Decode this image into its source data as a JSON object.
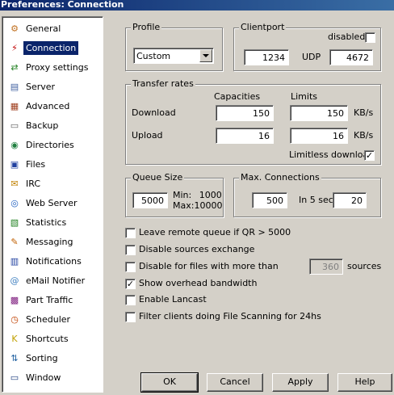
{
  "window": {
    "title": "Preferences: Connection"
  },
  "sidebar": {
    "items": [
      {
        "label": "General",
        "icon": "gear-icon",
        "color": "#c07020",
        "glyph": "⚙",
        "selected": false
      },
      {
        "label": "Connection",
        "icon": "plug-icon",
        "color": "#c00000",
        "glyph": "⚡",
        "selected": true
      },
      {
        "label": "Proxy settings",
        "icon": "proxy-icon",
        "color": "#208020",
        "glyph": "⇄",
        "selected": false
      },
      {
        "label": "Server",
        "icon": "server-icon",
        "color": "#4060a0",
        "glyph": "▤",
        "selected": false
      },
      {
        "label": "Advanced",
        "icon": "advanced-icon",
        "color": "#a04020",
        "glyph": "▦",
        "selected": false
      },
      {
        "label": "Backup",
        "icon": "backup-icon",
        "color": "#606060",
        "glyph": "▭",
        "selected": false
      },
      {
        "label": "Directories",
        "icon": "directories-icon",
        "color": "#208040",
        "glyph": "◉",
        "selected": false
      },
      {
        "label": "Files",
        "icon": "files-icon",
        "color": "#2040a0",
        "glyph": "▣",
        "selected": false
      },
      {
        "label": "IRC",
        "icon": "irc-icon",
        "color": "#c08000",
        "glyph": "✉",
        "selected": false
      },
      {
        "label": "Web Server",
        "icon": "web-server-icon",
        "color": "#2060c0",
        "glyph": "◎",
        "selected": false
      },
      {
        "label": "Statistics",
        "icon": "statistics-icon",
        "color": "#208020",
        "glyph": "▧",
        "selected": false
      },
      {
        "label": "Messaging",
        "icon": "messaging-icon",
        "color": "#c06000",
        "glyph": "✎",
        "selected": false
      },
      {
        "label": "Notifications",
        "icon": "notifications-icon",
        "color": "#2040a0",
        "glyph": "▥",
        "selected": false
      },
      {
        "label": "eMail Notifier",
        "icon": "email-icon",
        "color": "#4080c0",
        "glyph": "@",
        "selected": false
      },
      {
        "label": "Part Traffic",
        "icon": "part-traffic-icon",
        "color": "#802080",
        "glyph": "▩",
        "selected": false
      },
      {
        "label": "Scheduler",
        "icon": "clock-icon",
        "color": "#c04000",
        "glyph": "◷",
        "selected": false
      },
      {
        "label": "Shortcuts",
        "icon": "shortcuts-icon",
        "color": "#c0a000",
        "glyph": "K",
        "selected": false
      },
      {
        "label": "Sorting",
        "icon": "sorting-icon",
        "color": "#2060a0",
        "glyph": "⇅",
        "selected": false
      },
      {
        "label": "Window",
        "icon": "window-icon",
        "color": "#204080",
        "glyph": "▭",
        "selected": false
      }
    ]
  },
  "profile": {
    "title": "Profile",
    "selected": "Custom"
  },
  "clientport": {
    "title": "Clientport",
    "disabled_label": "disabled",
    "disabled_checked": false,
    "tcp_value": "1234",
    "udp_label": "UDP",
    "udp_value": "4672"
  },
  "transfer_rates": {
    "title": "Transfer rates",
    "capacities_header": "Capacities",
    "limits_header": "Limits",
    "download_label": "Download",
    "download_capacity": "150",
    "download_limit": "150",
    "download_unit": "KB/s",
    "upload_label": "Upload",
    "upload_capacity": "16",
    "upload_limit": "16",
    "upload_unit": "KB/s",
    "limitless_label": "Limitless download",
    "limitless_checked": true
  },
  "queue_size": {
    "title": "Queue Size",
    "value": "5000",
    "min_label": "Min:",
    "min_value": "1000",
    "max_label": "Max:10000"
  },
  "max_connections": {
    "title": "Max. Connections",
    "value": "500",
    "in5sec_label": "In 5 sec",
    "in5sec_value": "20"
  },
  "options": [
    {
      "label": "Leave remote queue if QR > 5000",
      "checked": false
    },
    {
      "label": "Disable sources exchange",
      "checked": false
    },
    {
      "label": "Disable for files with more than",
      "checked": false
    },
    {
      "label": "Show overhead bandwidth",
      "checked": true
    },
    {
      "label": "Enable Lancast",
      "checked": false
    },
    {
      "label": "Filter clients doing File Scanning for 24hs",
      "checked": false
    }
  ],
  "sources_field": {
    "value": "360",
    "unit": "sources"
  },
  "buttons": {
    "ok": "OK",
    "cancel": "Cancel",
    "apply": "Apply",
    "help": "Help"
  }
}
